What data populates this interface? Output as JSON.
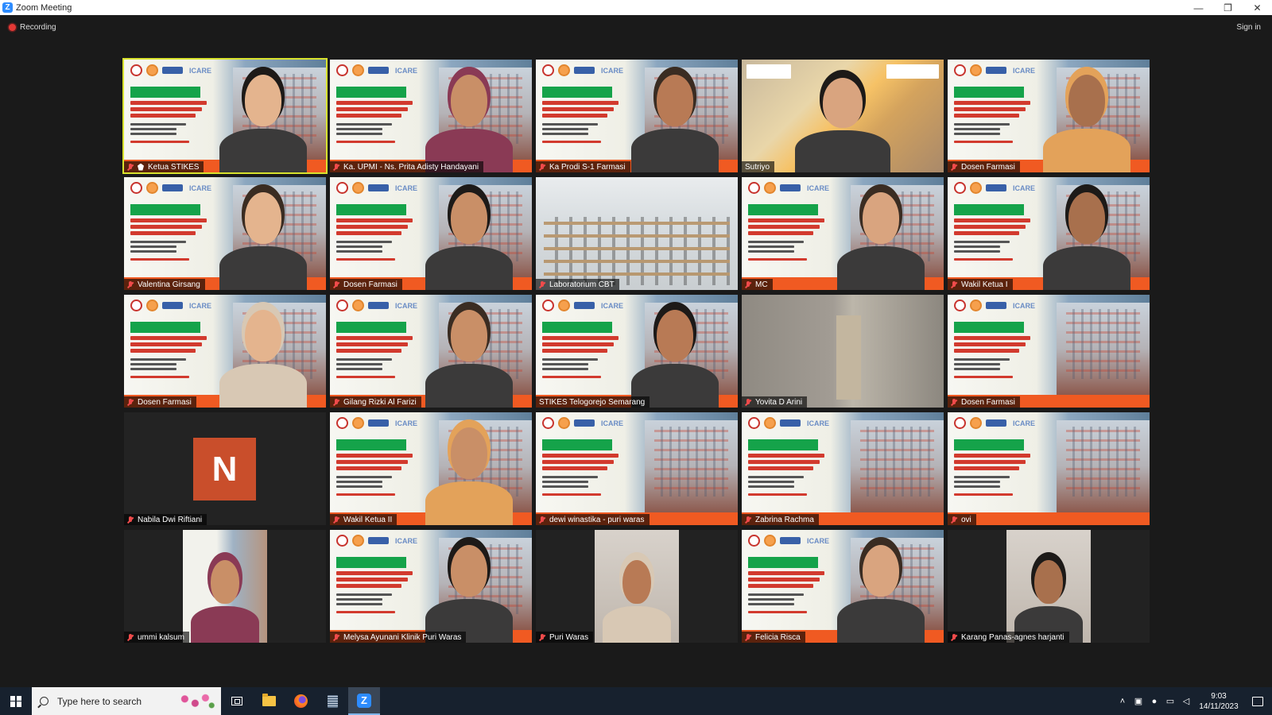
{
  "window": {
    "title": "Zoom Meeting",
    "minimize": "—",
    "restore": "❐",
    "close": "✕"
  },
  "meeting": {
    "recording_label": "Recording",
    "signin_label": "Sign in",
    "active_speaker": "Ketua STIKES",
    "participants": [
      {
        "name": "Ketua STIKES",
        "bg": "banner",
        "host": true,
        "muted": true
      },
      {
        "name": "Ka. UPMI - Ns. Prita Adisty Handayani",
        "bg": "banner",
        "muted": true
      },
      {
        "name": "Ka Prodi S-1 Farmasi",
        "bg": "banner",
        "muted": true
      },
      {
        "name": "Sutriyo",
        "bg": "video-office",
        "muted": false
      },
      {
        "name": "Dosen Farmasi",
        "bg": "banner",
        "muted": true
      },
      {
        "name": "Valentina Girsang",
        "bg": "banner",
        "muted": true
      },
      {
        "name": "Dosen Farmasi",
        "bg": "banner",
        "muted": true
      },
      {
        "name": "Laboratorium CBT",
        "bg": "video-lab",
        "muted": true
      },
      {
        "name": "MC",
        "bg": "banner",
        "muted": true
      },
      {
        "name": "Wakil Ketua I",
        "bg": "banner",
        "muted": true
      },
      {
        "name": "Dosen Farmasi",
        "bg": "banner",
        "muted": true
      },
      {
        "name": "Gilang Rizki Al Farizi",
        "bg": "banner",
        "muted": true
      },
      {
        "name": "STIKES Telogorejo Semarang",
        "bg": "banner",
        "muted": false
      },
      {
        "name": "Yovita D Arini",
        "bg": "video-blur",
        "muted": true
      },
      {
        "name": "Dosen Farmasi",
        "bg": "banner",
        "muted": true
      },
      {
        "name": "Nabila Dwi Riftiani",
        "bg": "avatar",
        "avatar_letter": "N",
        "muted": true
      },
      {
        "name": "Wakil Ketua II",
        "bg": "banner",
        "muted": true
      },
      {
        "name": "dewi winastika - puri waras",
        "bg": "banner",
        "muted": true
      },
      {
        "name": "Zabrina Rachma",
        "bg": "banner",
        "muted": true
      },
      {
        "name": "ovi",
        "bg": "banner",
        "muted": true
      },
      {
        "name": "ummi kalsum",
        "bg": "portrait-banner",
        "muted": true
      },
      {
        "name": "Melysa Ayunani Klinik Puri Waras",
        "bg": "banner",
        "muted": true
      },
      {
        "name": "Puri Waras",
        "bg": "portrait",
        "muted": true
      },
      {
        "name": "Felicia Risca",
        "bg": "banner",
        "muted": true
      },
      {
        "name": "Karang Panas-agnes harjanti",
        "bg": "portrait",
        "muted": true
      }
    ]
  },
  "taskbar": {
    "search_placeholder": "Type here to search",
    "clock_time": "9:03",
    "clock_date": "14/11/2023",
    "apps": [
      "task-view",
      "file-explorer",
      "firefox",
      "calculator",
      "zoom"
    ]
  },
  "colors": {
    "active_speaker_border": "#d8e22d",
    "muted_mic": "#f04b4b",
    "avatar_bg": "#c94e2b",
    "taskbar_bg": "#17212e",
    "banner_orange": "#f05a22",
    "banner_green": "#15a34a"
  }
}
